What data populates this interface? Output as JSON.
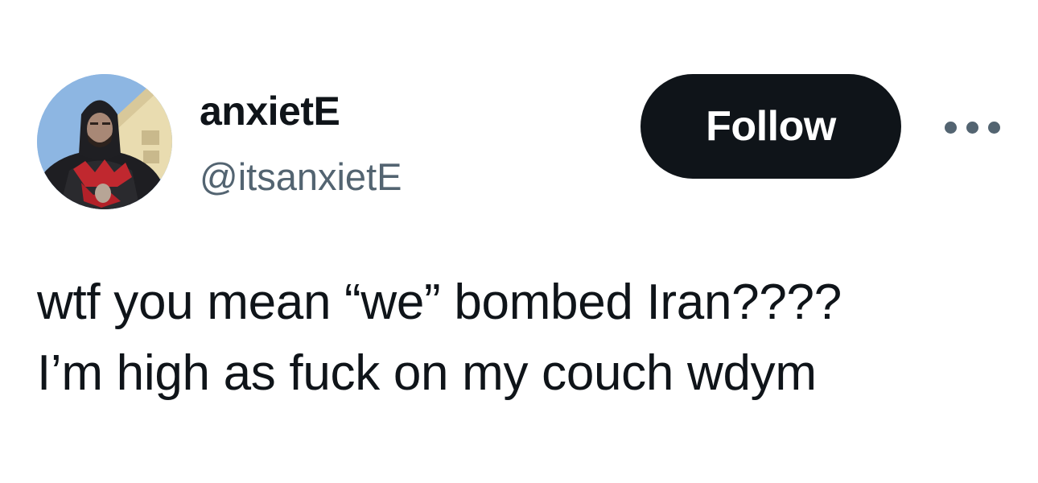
{
  "user": {
    "display_name": "anxietE",
    "handle": "@itsanxietE",
    "avatar_icon": "profile-photo"
  },
  "actions": {
    "follow_label": "Follow",
    "more_icon": "more-dots-icon"
  },
  "tweet": {
    "lines": [
      "wtf you mean “we” bombed Iran????",
      "I’m high as fuck on my couch wdym"
    ]
  },
  "colors": {
    "text_primary": "#0f1419",
    "text_secondary": "#536471",
    "button_bg": "#0f1419",
    "button_text": "#ffffff",
    "background": "#ffffff"
  }
}
